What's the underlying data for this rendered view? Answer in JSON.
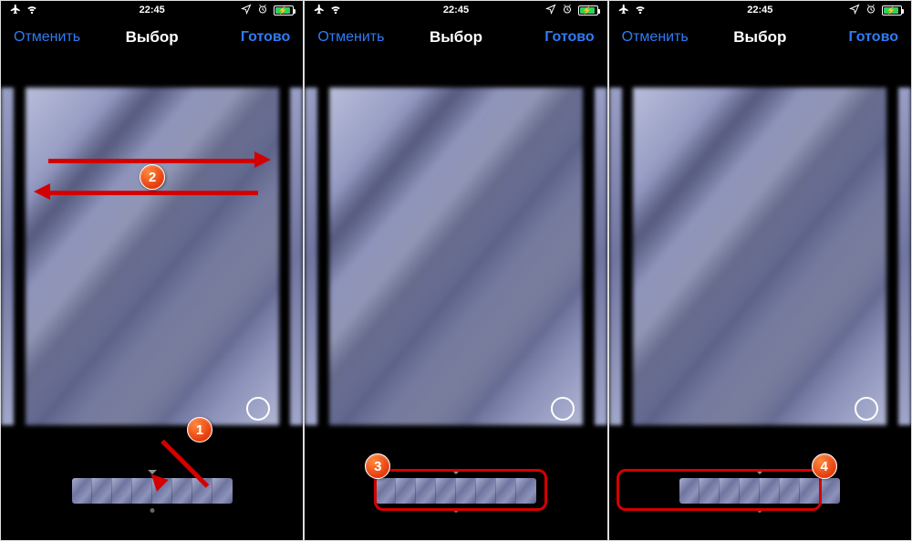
{
  "status": {
    "time": "22:45",
    "airplane": "airplane-icon",
    "wifi": "wifi-icon",
    "location": "location-icon",
    "alarm": "alarm-icon",
    "battery_icon": "battery-charging-icon"
  },
  "nav": {
    "cancel": "Отменить",
    "title": "Выбор",
    "done": "Готово"
  },
  "filmstrip": {
    "frame_count": 8
  },
  "annotations": {
    "b1": "1",
    "b2": "2",
    "b3": "3",
    "b4": "4"
  }
}
